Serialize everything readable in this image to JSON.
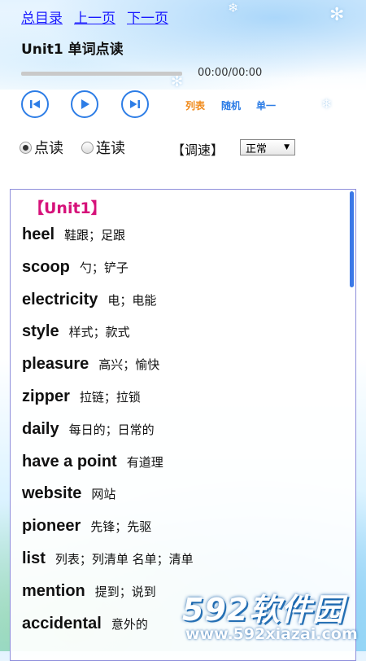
{
  "nav": {
    "home": "总目录",
    "prev": "上一页",
    "next": "下一页"
  },
  "title": "Unit1 单词点读",
  "player": {
    "time": "00:00/00:00",
    "progress_percent": 0,
    "modes": {
      "list": "列表",
      "random": "随机",
      "single": "单一"
    },
    "colors": {
      "list": "#f08a1a",
      "random": "#2d7de6",
      "single": "#2d7de6"
    }
  },
  "read_mode": {
    "point": "点读",
    "continuous": "连读",
    "selected": "point"
  },
  "speed": {
    "label": "【调速】",
    "value": "正常"
  },
  "unit_heading": "【Unit1】",
  "words": [
    {
      "en": "heel",
      "cn": "鞋跟；足跟"
    },
    {
      "en": "scoop",
      "cn": "勺；铲子"
    },
    {
      "en": "electricity",
      "cn": "电；电能"
    },
    {
      "en": "style",
      "cn": "样式；款式"
    },
    {
      "en": "pleasure",
      "cn": "高兴；愉快"
    },
    {
      "en": "zipper",
      "cn": "拉链；拉锁"
    },
    {
      "en": "daily",
      "cn": "每日的；日常的"
    },
    {
      "en": "have a point",
      "cn": "有道理"
    },
    {
      "en": "website",
      "cn": "网站"
    },
    {
      "en": "pioneer",
      "cn": "先锋；先驱"
    },
    {
      "en": "list",
      "cn": "列表；列清单 名单；清单"
    },
    {
      "en": "mention",
      "cn": "提到；说到"
    },
    {
      "en": "accidental",
      "cn": "意外的"
    }
  ],
  "watermark": {
    "brand": "592软件园",
    "url": "www.592xiazai.com"
  }
}
